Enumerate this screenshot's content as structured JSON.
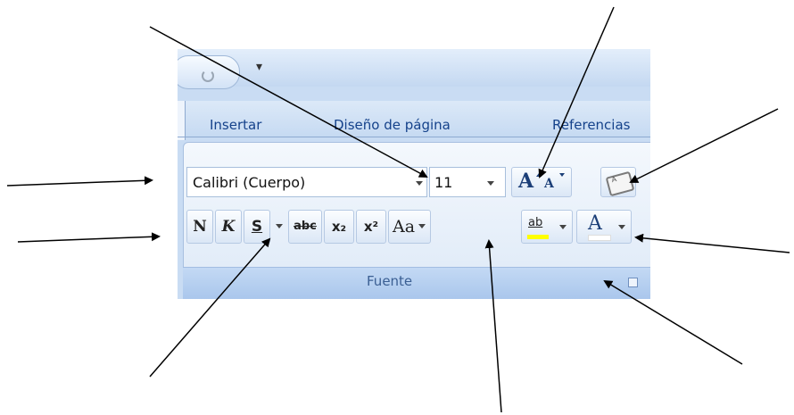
{
  "qat": {
    "more_glyph": "▾"
  },
  "tabs": [
    "Insertar",
    "Diseño de página",
    "Referencias"
  ],
  "font_group": {
    "font_name": "Calibri (Cuerpo)",
    "font_size": "11",
    "label": "Fuente",
    "format_buttons": [
      "N",
      "K",
      "S",
      "abc",
      "x₂",
      "x²",
      "Aa"
    ],
    "highlight_label": "ab",
    "font_color_label": "A",
    "grow_label": "A",
    "shrink_label": "A"
  },
  "colors": {
    "highlight": "#ffff00",
    "arrow": "#000000",
    "tab_text": "#15428b",
    "ribbon_bg": "#c9dcf3"
  }
}
